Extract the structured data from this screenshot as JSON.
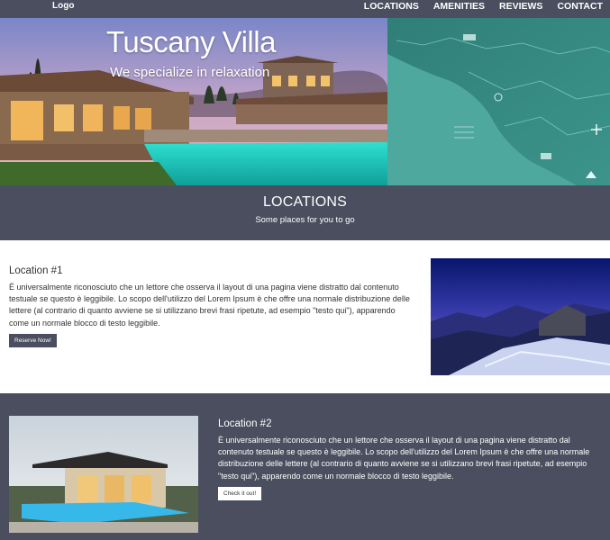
{
  "nav": {
    "logo": "Logo",
    "items": [
      "LOCATIONS",
      "AMENITIES",
      "REVIEWS",
      "CONTACT"
    ]
  },
  "hero": {
    "title": "Tuscany Villa",
    "subtitle": "We specialize in relaxation"
  },
  "locations_section": {
    "title": "LOCATIONS",
    "subtitle": "Some places for you to go"
  },
  "locations": [
    {
      "title": "Location #1",
      "description": "È universalmente riconosciuto che un lettore che osserva il layout di una pagina viene distratto dal contenuto testuale se questo è leggibile. Lo scopo dell'utilizzo del Lorem Ipsum è che offre una normale distribuzione delle lettere (al contrario di quanto avviene se si utilizzano brevi frasi ripetute, ad esempio \"testo qui\"), apparendo come un normale blocco di testo leggibile.",
      "button": "Reserve Now!"
    },
    {
      "title": "Location #2",
      "description": "È universalmente riconosciuto che un lettore che osserva il layout di una pagina viene distratto dal contenuto testuale se questo è leggibile. Lo scopo dell'utilizzo del Lorem Ipsum è che offre una normale distribuzione delle lettere (al contrario di quanto avviene se si utilizzano brevi frasi ripetute, ad esempio \"testo qui\"), apparendo come un normale blocco di testo leggibile.",
      "button": "Check it out!"
    }
  ],
  "colors": {
    "nav_bg": "#4a4e5e",
    "map_teal": "#3f8f85",
    "pool": "#37d6c4"
  }
}
